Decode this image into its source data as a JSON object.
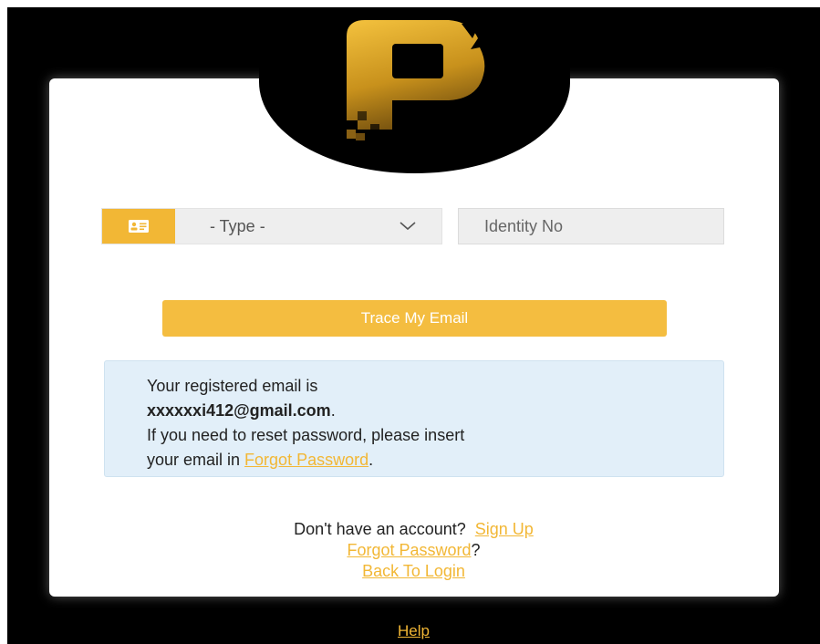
{
  "form": {
    "type_select_value": "- Type -",
    "identity_placeholder": "Identity No",
    "trace_button_label": "Trace My Email"
  },
  "alert": {
    "line1": "Your registered email is",
    "email": "xxxxxxi412@gmail.com",
    "email_suffix": ".",
    "line3": "If you need to reset password, please insert",
    "line4_prefix": "your email in ",
    "line4_link": "Forgot Password",
    "line4_suffix": "."
  },
  "footer": {
    "no_account_text": "Don't have an account?",
    "sign_up_label": "Sign Up",
    "forgot_password_label": "Forgot Password",
    "forgot_password_suffix": "?",
    "back_to_login_label": "Back To Login"
  },
  "help_label": "Help",
  "colors": {
    "accent": "#f2b735",
    "alert_bg": "#e2eff9",
    "page_bg": "#000000"
  },
  "icons": {
    "id_card": "id-card-icon",
    "chevron": "chevron-down-icon",
    "logo": "brand-logo"
  }
}
